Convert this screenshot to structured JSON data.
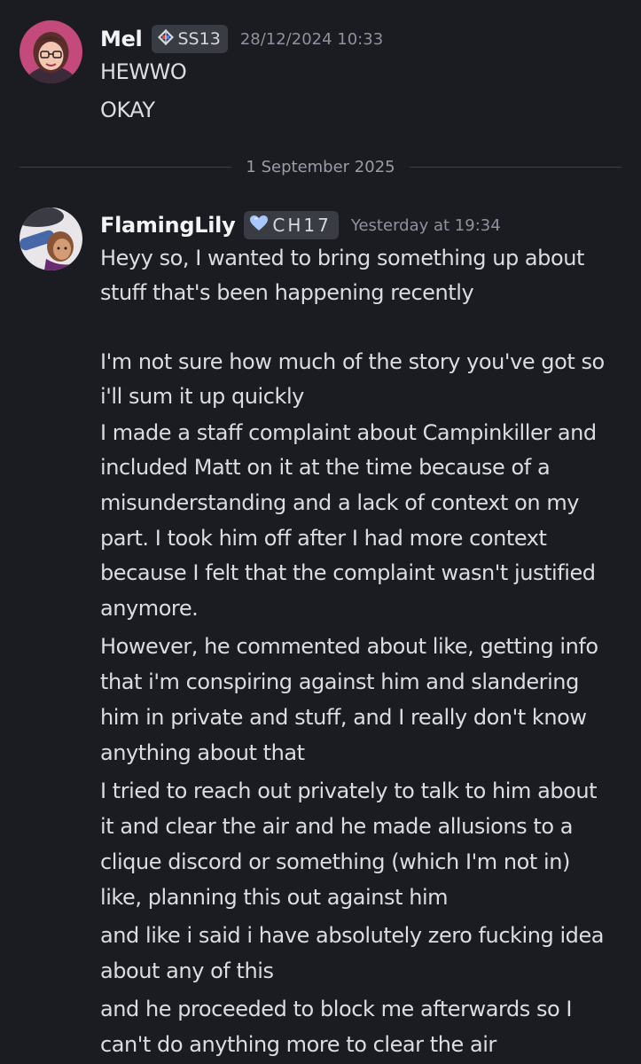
{
  "messages": [
    {
      "author": "Mel",
      "tag": "SS13",
      "timestamp": "28/12/2024 10:33",
      "lines": [
        "HEWWO",
        "OKAY"
      ]
    },
    {
      "author": "FlamingLily",
      "tag": "CH17",
      "timestamp": "Yesterday at 19:34",
      "lines": [
        "Heyy so, I wanted to bring something up about",
        "stuff that's been happening recently",
        "",
        "I'm not sure how much of the story you've got so",
        "i'll sum it up quickly",
        "I made a staff complaint about Campinkiller and",
        "included Matt on it at the time because of a",
        "misunderstanding and a lack of context on my",
        "part. I took him off after I had more context",
        "because I felt that the complaint wasn't justified",
        "anymore.",
        "However, he commented about like, getting info",
        "that i'm conspiring against him and slandering",
        "him in private and stuff, and I really don't know",
        "anything about that",
        "I tried to reach out privately to talk to him about",
        "it and clear the air and he made allusions to a",
        "clique discord or something (which I'm not in)",
        "like, planning this out against him",
        "and like i said i have absolutely zero fucking idea",
        "about any of this",
        "and he proceeded to block me afterwards so I",
        "can't do anything more to clear the air"
      ]
    }
  ],
  "divider": {
    "date": "1 September 2025"
  },
  "icons": {
    "mel_tag_icon": "diamond-compass-icon",
    "lily_tag_icon": "heart-icon"
  },
  "colors": {
    "background": "#1b1c21",
    "username": "#f2f3f5",
    "tag_bg": "#3a3c44",
    "timestamp": "#8f929c",
    "text": "#dcdde1",
    "heart": "#a9c7ff"
  }
}
